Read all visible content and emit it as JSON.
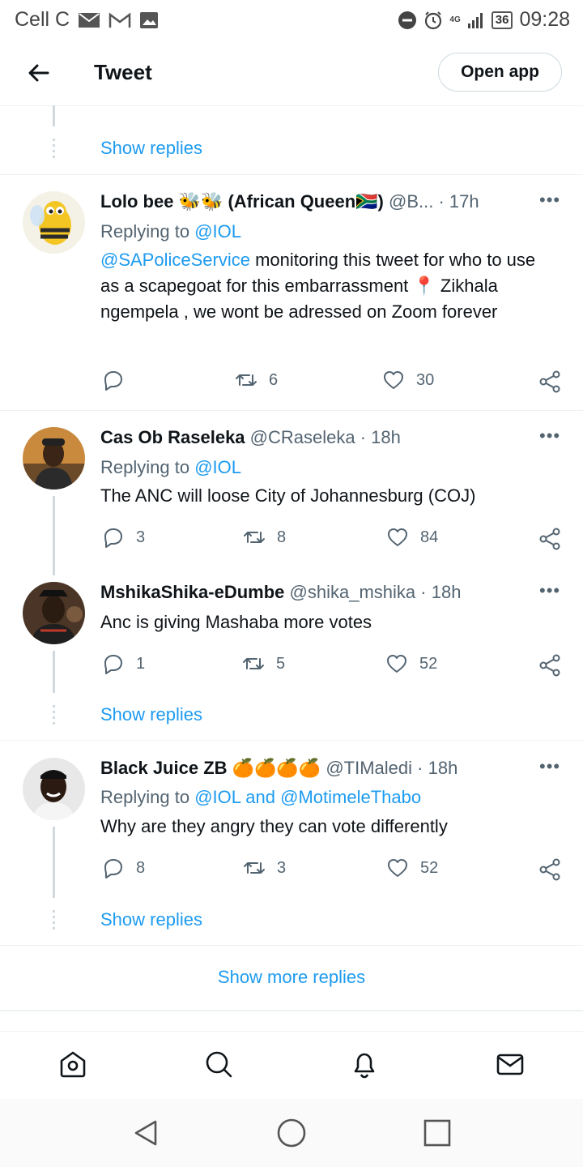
{
  "status": {
    "carrier": "Cell C",
    "network": "4G",
    "battery": "36",
    "time": "09:28"
  },
  "header": {
    "title": "Tweet",
    "open_app": "Open app"
  },
  "show_replies": "Show replies",
  "show_more_replies": "Show more replies",
  "tweets": [
    {
      "name": "Lolo bee 🐝🐝 (African Queen🇿🇦)",
      "handle": "@B...",
      "time": "· 17h",
      "replying_prefix": "Replying to",
      "replying_targets": "@IOL",
      "body_mention": "@SAPoliceService",
      "body": " monitoring this tweet for who to use as a scapegoat for this embarrassment 📍 Zikhala ngempela , we wont be adressed on Zoom forever",
      "replies": "",
      "retweets": "6",
      "likes": "30"
    },
    {
      "name": "Cas Ob Raseleka",
      "handle": "@CRaseleka",
      "time": "· 18h",
      "replying_prefix": "Replying to",
      "replying_targets": "@IOL",
      "body": "The ANC will loose City of Johannesburg (COJ)",
      "replies": "3",
      "retweets": "8",
      "likes": "84"
    },
    {
      "name": "MshikaShika-eDumbe",
      "handle": "@shika_mshika",
      "time": "· 18h",
      "body": "Anc is giving Mashaba more votes",
      "replies": "1",
      "retweets": "5",
      "likes": "52"
    },
    {
      "name": "Black Juice ZB 🍊🍊🍊🍊",
      "handle": "@TIMaledi",
      "time": "· 18h",
      "replying_prefix": "Replying to",
      "replying_targets": "@IOL and @MotimeleThabo",
      "body": "Why are they angry they can vote differently",
      "replies": "8",
      "retweets": "3",
      "likes": "52"
    }
  ],
  "icons": {
    "back": "arrow-left-icon",
    "reply": "reply-icon",
    "retweet": "retweet-icon",
    "like": "heart-icon",
    "share": "share-icon",
    "more": "more-icon",
    "home": "home-icon",
    "search": "search-icon",
    "notifications": "bell-icon",
    "messages": "mail-icon"
  },
  "colors": {
    "link": "#1d9bf0",
    "text": "#0f1419",
    "muted": "#536471"
  }
}
